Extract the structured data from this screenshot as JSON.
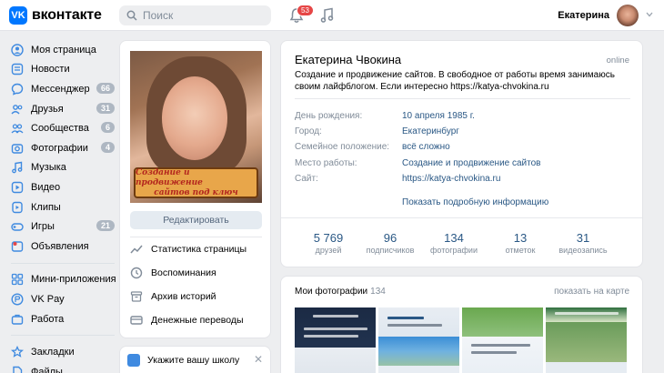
{
  "header": {
    "logo_mark": "VK",
    "logo_text": "вконтакте",
    "search_placeholder": "Поиск",
    "notifications_count": "53",
    "user_name": "Екатерина"
  },
  "sidebar": {
    "items": [
      {
        "label": "Моя страница",
        "icon": "user-icon",
        "count": ""
      },
      {
        "label": "Новости",
        "icon": "news-icon",
        "count": ""
      },
      {
        "label": "Мессенджер",
        "icon": "message-icon",
        "count": "66"
      },
      {
        "label": "Друзья",
        "icon": "friends-icon",
        "count": "31"
      },
      {
        "label": "Сообщества",
        "icon": "communities-icon",
        "count": "6"
      },
      {
        "label": "Фотографии",
        "icon": "photo-icon",
        "count": "4"
      },
      {
        "label": "Музыка",
        "icon": "music-icon",
        "count": ""
      },
      {
        "label": "Видео",
        "icon": "video-icon",
        "count": ""
      },
      {
        "label": "Клипы",
        "icon": "clips-icon",
        "count": ""
      },
      {
        "label": "Игры",
        "icon": "games-icon",
        "count": "21"
      },
      {
        "label": "Объявления",
        "icon": "ads-icon",
        "count": ""
      }
    ],
    "items2": [
      {
        "label": "Мини-приложения",
        "icon": "apps-icon"
      },
      {
        "label": "VK Pay",
        "icon": "vkpay-icon"
      },
      {
        "label": "Работа",
        "icon": "work-icon"
      }
    ],
    "items3": [
      {
        "label": "Закладки",
        "icon": "bookmark-icon"
      },
      {
        "label": "Файлы",
        "icon": "files-icon"
      }
    ]
  },
  "profile_card": {
    "banner_line1": "Создание и продвижение",
    "banner_line2": "сайтов под ключ",
    "edit_button": "Редактировать",
    "actions": [
      {
        "label": "Статистика страницы",
        "icon": "stats-icon"
      },
      {
        "label": "Воспоминания",
        "icon": "memories-icon"
      },
      {
        "label": "Архив историй",
        "icon": "archive-icon"
      },
      {
        "label": "Денежные переводы",
        "icon": "money-icon"
      }
    ]
  },
  "school_prompt": {
    "text": "Укажите вашу школу"
  },
  "info": {
    "name": "Екатерина Чвокина",
    "online": "online",
    "status": "Создание и продвижение сайтов. В свободное от работы время занимаюсь своим лайфблогом. Если интересно https://katya-chvokina.ru",
    "rows": [
      {
        "key": "День рождения:",
        "value": "10 апреля 1985 г."
      },
      {
        "key": "Город:",
        "value": "Екатеринбург"
      },
      {
        "key": "Семейное положение:",
        "value": "всё сложно"
      },
      {
        "key": "Место работы:",
        "value": "Создание и продвижение сайтов"
      },
      {
        "key": "Сайт:",
        "value": "https://katya-chvokina.ru"
      }
    ],
    "more_link": "Показать подробную информацию",
    "stats": [
      {
        "n": "5 769",
        "l": "друзей"
      },
      {
        "n": "96",
        "l": "подписчиков"
      },
      {
        "n": "134",
        "l": "фотографии"
      },
      {
        "n": "13",
        "l": "отметок"
      },
      {
        "n": "31",
        "l": "видеозапись"
      }
    ]
  },
  "photos": {
    "title": "Мои фотографии",
    "count": "134",
    "map_link": "показать на карте"
  },
  "colors": {
    "brand": "#0077ff",
    "link": "#2a5885",
    "badge": "#e64646",
    "background": "#edeef0"
  }
}
